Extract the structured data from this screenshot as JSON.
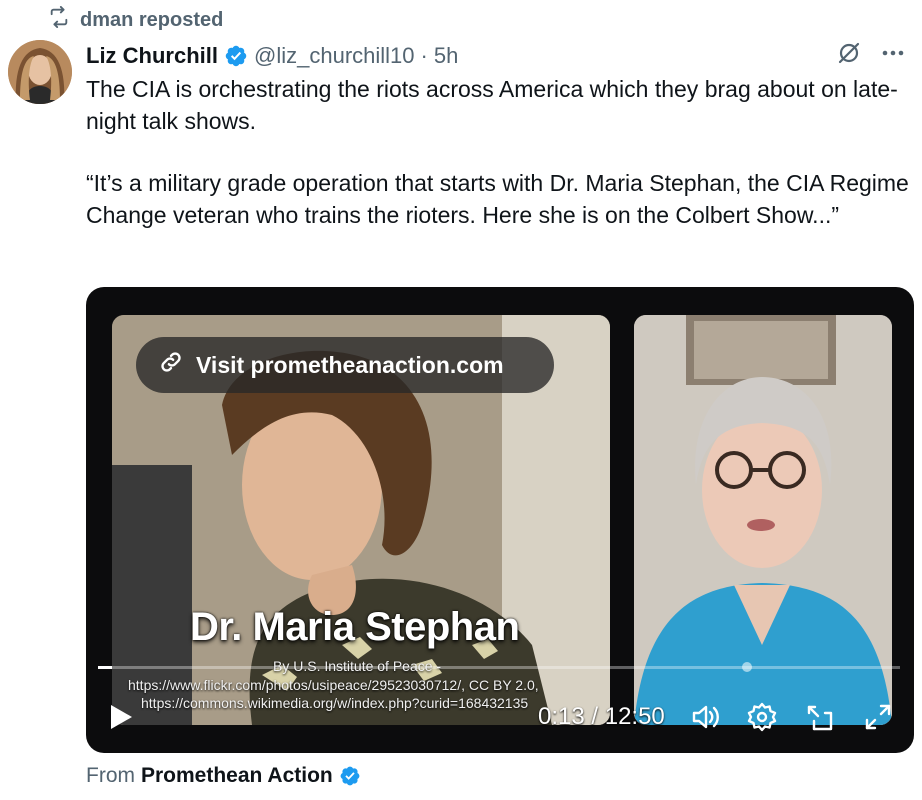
{
  "repost": {
    "label": "dman reposted"
  },
  "author": {
    "name": "Liz Churchill",
    "handle": "@liz_churchill10",
    "separator": "·",
    "time": "5h"
  },
  "tweet": {
    "paragraph1": "The CIA is orchestrating the riots across America which they brag about on late-night talk shows.",
    "paragraph2": "“It’s a military grade operation that starts with Dr. Maria Stephan, the CIA Regime Change veteran who trains the rioters. Here she is on the Colbert Show...”"
  },
  "video": {
    "visit_label": "Visit prometheanaction.com",
    "name_caption": "Dr. Maria Stephan",
    "credit_line1": "By U.S. Institute of Peace -",
    "credit_line2": "https://www.flickr.com/photos/usipeace/29523030712/, CC BY 2.0,",
    "credit_line3": "https://commons.wikimedia.org/w/index.php?curid=168432135",
    "time_readout": "0:13 / 12:50",
    "progress": 0.017
  },
  "source": {
    "prefix": "From",
    "name": "Promethean Action"
  },
  "icons": {
    "repost": "repost-icon",
    "verified": "verified-badge-icon",
    "grok": "grok-icon",
    "more": "more-icon",
    "link": "link-icon",
    "play": "play-icon",
    "volume": "volume-icon",
    "settings": "settings-icon",
    "pip": "picture-in-picture-icon",
    "fullscreen": "fullscreen-icon"
  },
  "colors": {
    "verified": "#1d9bf0",
    "secondary_text": "#536471",
    "primary_text": "#0f1419"
  }
}
